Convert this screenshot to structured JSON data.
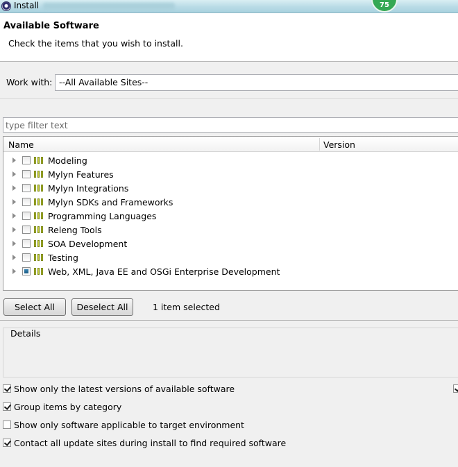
{
  "window": {
    "title": "Install",
    "badge": "75"
  },
  "header": {
    "title": "Available Software",
    "subtitle": "Check the items that you wish to install."
  },
  "work_with": {
    "label": "Work with:",
    "value": "--All Available Sites--"
  },
  "filter": {
    "placeholder": "type filter text"
  },
  "table": {
    "columns": [
      "Name",
      "Version"
    ],
    "rows": [
      {
        "label": "Modeling",
        "state": "unchecked"
      },
      {
        "label": "Mylyn Features",
        "state": "unchecked"
      },
      {
        "label": "Mylyn Integrations",
        "state": "unchecked"
      },
      {
        "label": "Mylyn SDKs and Frameworks",
        "state": "unchecked"
      },
      {
        "label": "Programming Languages",
        "state": "unchecked"
      },
      {
        "label": "Releng Tools",
        "state": "unchecked"
      },
      {
        "label": "SOA Development",
        "state": "unchecked"
      },
      {
        "label": "Testing",
        "state": "unchecked"
      },
      {
        "label": "Web, XML, Java EE and OSGi Enterprise Development",
        "state": "partial"
      }
    ]
  },
  "buttons": {
    "select_all": "Select All",
    "deselect_all": "Deselect All"
  },
  "selection_status": "1 item selected",
  "details": {
    "label": "Details"
  },
  "options": [
    {
      "label": "Show only the latest versions of available software",
      "checked": true
    },
    {
      "label": "Group items by category",
      "checked": true
    },
    {
      "label": "Show only software applicable to target environment",
      "checked": false
    },
    {
      "label": "Contact all update sites during install to find required software",
      "checked": true
    }
  ]
}
